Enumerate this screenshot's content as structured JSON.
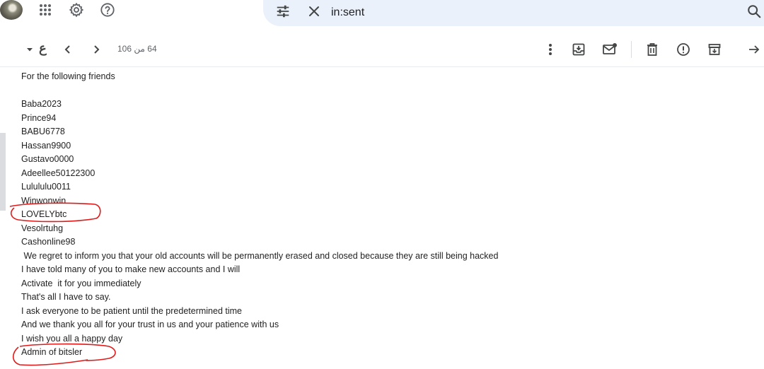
{
  "search": {
    "query": "in:sent"
  },
  "toolbar": {
    "select_label": "ع",
    "pager": "64 من 106"
  },
  "email": {
    "lines": [
      "For the following friends",
      "",
      "Baba2023",
      "Prince94",
      "BABU6778",
      "Hassan9900",
      "Gustavo0000",
      "Adeellee50122300",
      "Lulululu0011",
      "Winwonwin",
      "LOVELYbtc",
      "Vesolrtuhg",
      "Cashonline98",
      " We regret to inform you that your old accounts will be permanently erased and closed because they are still being hacked",
      "I have told many of you to make new accounts and I will",
      "Activate  it for you immediately",
      "That's all I have to say.",
      "I ask everyone to be patient until the predetermined time",
      "And we thank you all for your trust in us and your patience with us",
      "I wish you all a happy day",
      "Admin of bitsler"
    ]
  },
  "icons": {
    "apps": "apps-grid-icon",
    "settings": "gear-icon",
    "help": "help-icon",
    "filters": "tune-icon",
    "clear": "close-icon",
    "search": "search-icon",
    "dropdown": "caret-down-icon",
    "prev": "chevron-left-icon",
    "next": "chevron-right-icon",
    "more": "more-vert-icon",
    "move_inbox": "move-to-inbox-icon",
    "mark_unread": "mark-unread-icon",
    "delete": "trash-icon",
    "spam": "report-spam-icon",
    "archive": "archive-icon",
    "forward": "arrow-right-icon"
  },
  "colors": {
    "annotation": "#e01b1b",
    "search_bg": "#eaf1fb",
    "icon": "#444746"
  }
}
